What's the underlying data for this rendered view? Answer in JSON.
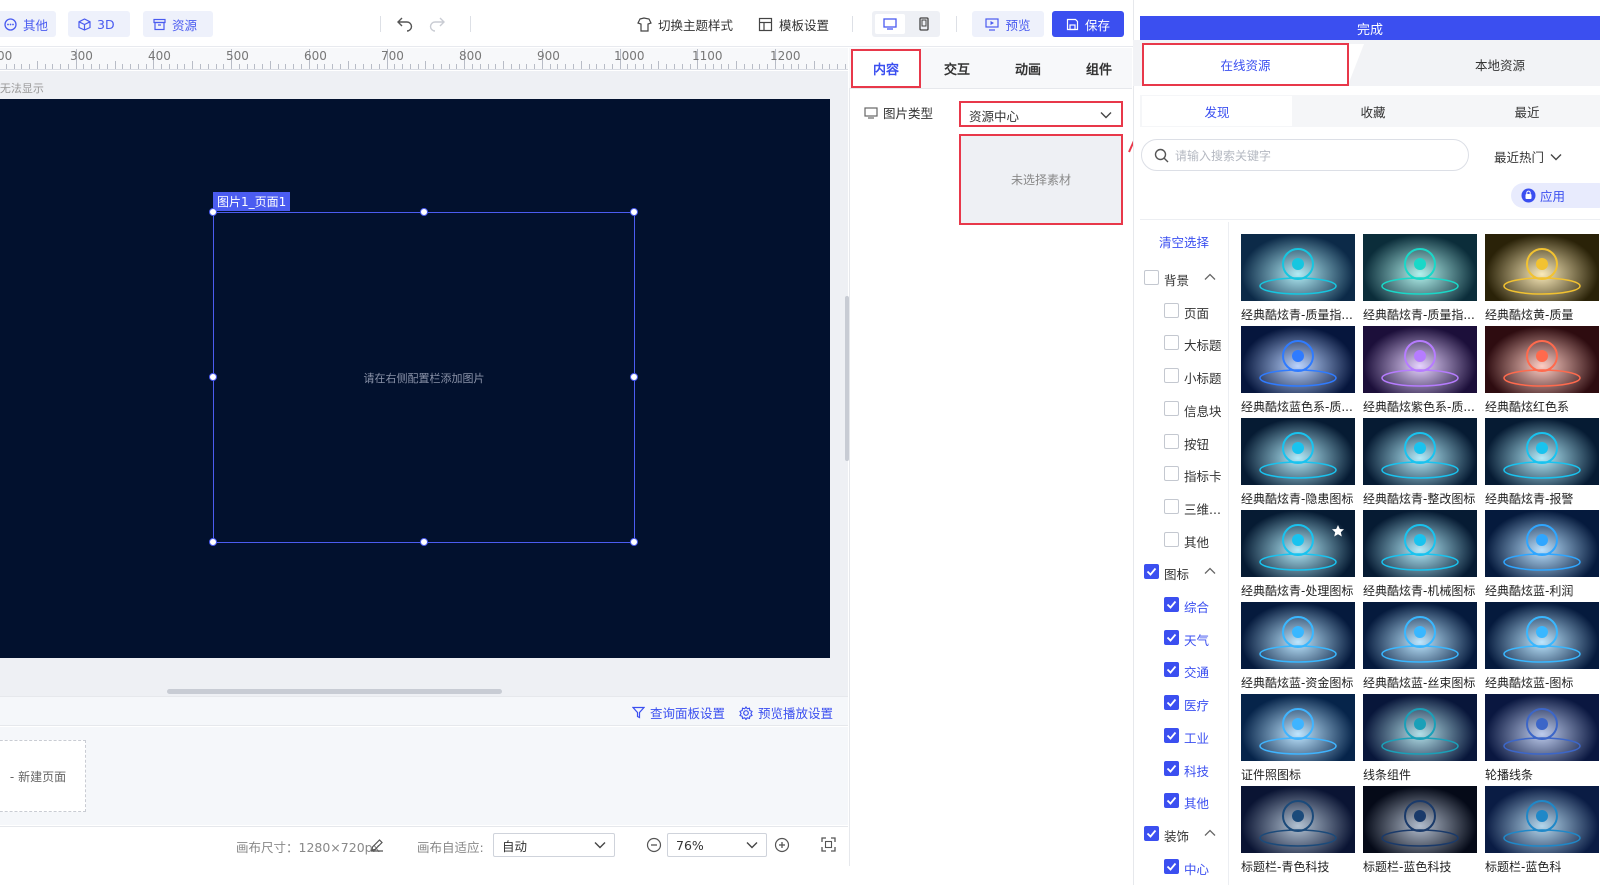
{
  "toolbar": {
    "other_label": "其他",
    "threed_label": "3D",
    "resource_label": "资源",
    "switch_theme_label": "切换主题样式",
    "template_settings_label": "模板设置",
    "preview_label": "预览",
    "save_label": "保存"
  },
  "ruler": {
    "labels": [
      "00",
      "300",
      "400",
      "500",
      "600",
      "700",
      "800",
      "900",
      "1000",
      "1100",
      "1200"
    ]
  },
  "canvas": {
    "hint_left": "f无法显示",
    "element_label": "图片1_页面1",
    "placeholder": "请在右侧配置栏添加图片",
    "background": "#02112e",
    "accent": "#4b5cf0"
  },
  "panel_bar": {
    "query_panel_label": "查询面板设置",
    "preview_play_label": "预览播放设置"
  },
  "pages": {
    "new_page_label": "- 新建页面"
  },
  "status": {
    "canvas_size_label": "画布尺寸：1280×720px",
    "auto_fit_label": "画布自适应:",
    "auto_fit_value": "自动",
    "zoom_value": "76%"
  },
  "config": {
    "tabs": [
      "内容",
      "交互",
      "动画",
      "组件"
    ],
    "image_type_label": "图片类型",
    "image_type_value": "资源中心",
    "no_material_text": "未选择素材"
  },
  "resources": {
    "done_label": "完成",
    "source_tabs": [
      "在线资源",
      "本地资源"
    ],
    "sub_tabs": [
      "发现",
      "收藏",
      "最近"
    ],
    "search_placeholder": "请输入搜索关键字",
    "sort_value": "最近热门",
    "apply_label": "应用",
    "clear_label": "清空选择",
    "categories": {
      "background": {
        "label": "背景",
        "checked": false,
        "items": [
          "页面",
          "大标题",
          "小标题",
          "信息块",
          "按钮",
          "指标卡",
          "三维...",
          "其他"
        ]
      },
      "icon": {
        "label": "图标",
        "checked": true,
        "items": [
          "综合",
          "天气",
          "交通",
          "医疗",
          "工业",
          "科技",
          "其他"
        ]
      },
      "decoration": {
        "label": "装饰",
        "checked": true,
        "items": [
          "中心"
        ]
      }
    },
    "grid": [
      [
        "经典酷炫青-质量指...",
        "经典酷炫青-质量指...",
        "经典酷炫黄-质量"
      ],
      [
        "经典酷炫蓝色系-质...",
        "经典酷炫紫色系-质...",
        "经典酷炫红色系"
      ],
      [
        "经典酷炫青-隐患图标",
        "经典酷炫青-整改图标",
        "经典酷炫青-报警"
      ],
      [
        "经典酷炫青-处理图标",
        "经典酷炫青-机械图标",
        "经典酷炫蓝-利润"
      ],
      [
        "经典酷炫蓝-资金图标",
        "经典酷炫蓝-丝束图标",
        "经典酷炫蓝-图标"
      ],
      [
        "证件照图标",
        "线条组件",
        "轮播线条"
      ],
      [
        "标题栏-青色科技",
        "标题栏-蓝色科技",
        "标题栏-蓝色科"
      ]
    ]
  }
}
